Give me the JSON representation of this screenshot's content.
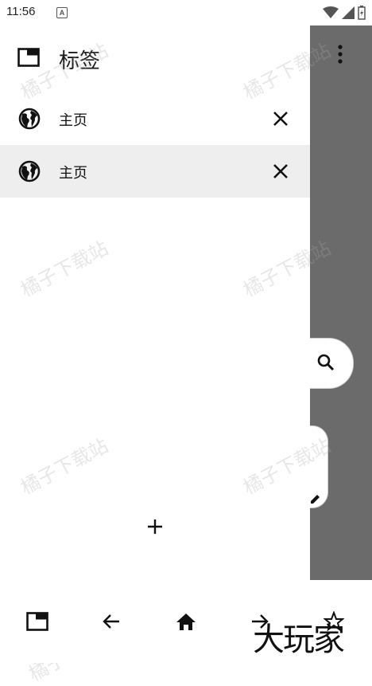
{
  "status_bar": {
    "time": "11:56",
    "notification_icon_letter": "A"
  },
  "drawer": {
    "title": "标签",
    "tabs": [
      {
        "label": "主页",
        "selected": false
      },
      {
        "label": "主页",
        "selected": true
      }
    ]
  },
  "watermark_text": "橘子下载站",
  "brand_mark_text": "大玩家",
  "icons": {
    "header": "tabs-icon",
    "tab": "globe-icon",
    "close": "close-icon",
    "new_tab": "plus-icon",
    "overflow": "more-vert-icon",
    "search": "search-icon",
    "edit": "edit-icon",
    "bottom": [
      "tabs-icon",
      "back-arrow-icon",
      "home-icon",
      "forward-arrow-icon",
      "star-icon"
    ]
  },
  "colors": {
    "scrim": "#6b6b6b",
    "selected_row": "#eeeeee"
  }
}
